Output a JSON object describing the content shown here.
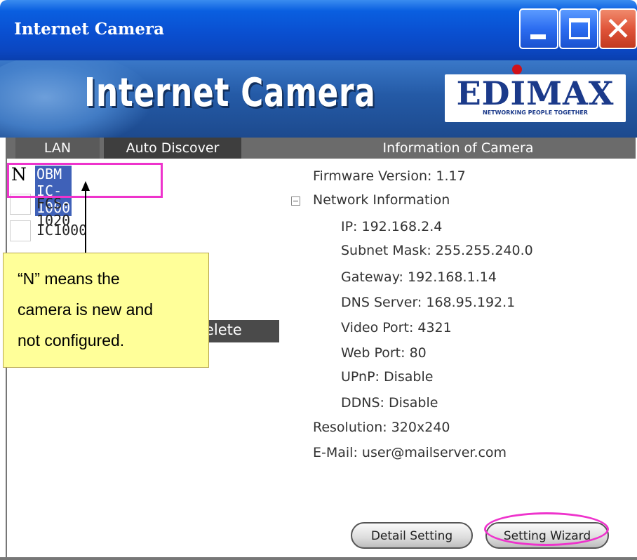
{
  "window": {
    "title": "Internet Camera",
    "buttons": {
      "minimize": "minimize-icon",
      "maximize": "maximize-icon",
      "close": "close-icon"
    }
  },
  "banner": {
    "title": "Internet Camera",
    "logo": "EDIMAX",
    "logo_tagline": "NETWORKING PEOPLE TOGETHER"
  },
  "tabs": {
    "lan": "LAN",
    "auto_discover": "Auto Discover",
    "info": "Information of Camera"
  },
  "camera_list": [
    {
      "flag": "N",
      "name": "OBM IC-1000",
      "selected": true
    },
    {
      "flag": "",
      "name": "FCS-1020",
      "selected": false
    },
    {
      "flag": "",
      "name": "IC1000",
      "selected": false
    }
  ],
  "left_actions": {
    "delete_label": "elete"
  },
  "callout": {
    "text": "“N” means the\ncamera is new and\nnot configured."
  },
  "info": {
    "firmware": "Firmware Version:  1.17",
    "network_header": "Network Information",
    "ip": "IP:  192.168.2.4",
    "subnet": "Subnet Mask:  255.255.240.0",
    "gateway": "Gateway:  192.168.1.14",
    "dns": "DNS Server:  168.95.192.1",
    "video_port": "Video Port:  4321",
    "web_port": "Web Port:  80",
    "upnp": "UPnP:  Disable",
    "ddns": "DDNS:  Disable",
    "resolution": "Resolution: 320x240",
    "email": "E-Mail: user@mailserver.com"
  },
  "buttons": {
    "detail": "Detail Setting",
    "wizard": "Setting Wizard"
  },
  "colors": {
    "highlight": "#ee33cc",
    "selection": "#3f61b8",
    "callout_bg": "#ffff99"
  }
}
